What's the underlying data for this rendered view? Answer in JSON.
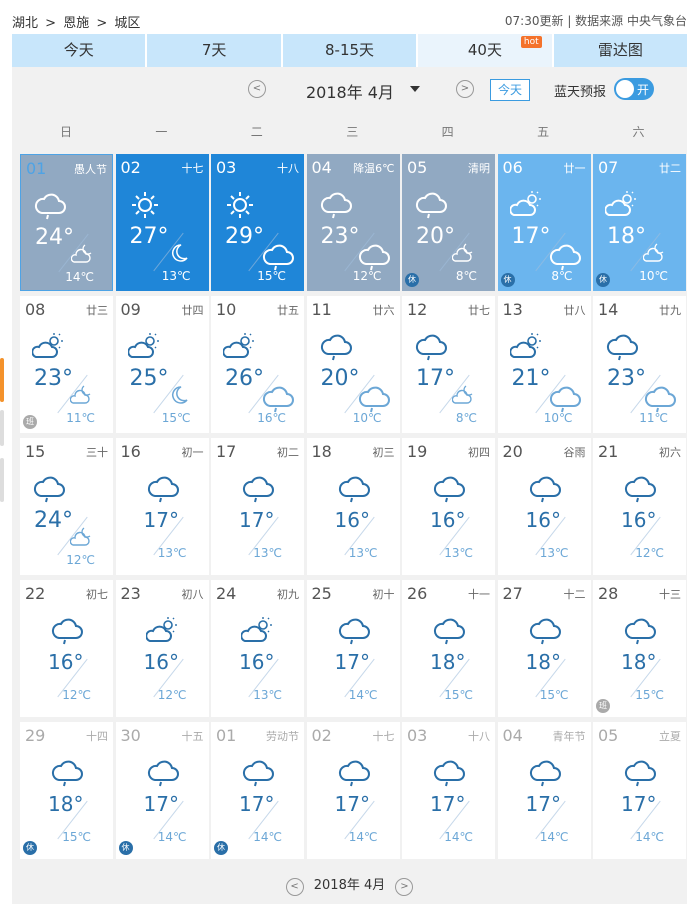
{
  "breadcrumb": [
    "湖北",
    ">",
    "恩施",
    ">",
    "城区"
  ],
  "update": {
    "time": "07:30更新",
    "source": "| 数据来源 中央气象台"
  },
  "tabs": [
    {
      "label": "今天"
    },
    {
      "label": "7天"
    },
    {
      "label": "8-15天"
    },
    {
      "label": "40天",
      "badge": "hot",
      "active": true
    },
    {
      "label": "雷达图"
    }
  ],
  "bar": {
    "month": "2018年 4月",
    "today": "今天",
    "lantian": "蓝天预报",
    "toggle": "开"
  },
  "weekdays": [
    "日",
    "一",
    "二",
    "三",
    "四",
    "五",
    "六"
  ],
  "cells": [
    {
      "day": "01",
      "lunar": "愚人节",
      "high": "24°",
      "low": "14℃",
      "style": "first",
      "w": "rain",
      "n": "cloud-moon",
      "tag": ""
    },
    {
      "day": "02",
      "lunar": "十七",
      "high": "27°",
      "low": "13℃",
      "style": "blue",
      "w": "sun",
      "n": "moon",
      "tag": ""
    },
    {
      "day": "03",
      "lunar": "十八",
      "high": "29°",
      "low": "15℃",
      "style": "blue",
      "w": "sun",
      "n": "rain",
      "tag": ""
    },
    {
      "day": "04",
      "lunar": "降温6℃",
      "high": "23°",
      "low": "12℃",
      "style": "grey",
      "w": "rain",
      "n": "rain",
      "tag": ""
    },
    {
      "day": "05",
      "lunar": "清明",
      "high": "20°",
      "low": "8℃",
      "style": "grey",
      "w": "rain",
      "n": "cloud-moon",
      "tag": "休"
    },
    {
      "day": "06",
      "lunar": "廿一",
      "high": "17°",
      "low": "8℃",
      "style": "light",
      "w": "sun-cloud",
      "n": "rain",
      "tag": "休"
    },
    {
      "day": "07",
      "lunar": "廿二",
      "high": "18°",
      "low": "10℃",
      "style": "light",
      "w": "sun-cloud",
      "n": "cloud-moon",
      "tag": "休"
    },
    {
      "day": "08",
      "lunar": "廿三",
      "high": "23°",
      "low": "11℃",
      "style": "",
      "w": "sun-cloud",
      "n": "cloud-moon",
      "tag": "班"
    },
    {
      "day": "09",
      "lunar": "廿四",
      "high": "25°",
      "low": "15℃",
      "style": "",
      "w": "sun-cloud",
      "n": "moon",
      "tag": ""
    },
    {
      "day": "10",
      "lunar": "廿五",
      "high": "26°",
      "low": "16℃",
      "style": "",
      "w": "sun-cloud",
      "n": "rain",
      "tag": ""
    },
    {
      "day": "11",
      "lunar": "廿六",
      "high": "20°",
      "low": "10℃",
      "style": "",
      "w": "rain",
      "n": "rain",
      "tag": ""
    },
    {
      "day": "12",
      "lunar": "廿七",
      "high": "17°",
      "low": "8℃",
      "style": "",
      "w": "rain",
      "n": "cloud-moon",
      "tag": ""
    },
    {
      "day": "13",
      "lunar": "廿八",
      "high": "21°",
      "low": "10℃",
      "style": "",
      "w": "sun-cloud",
      "n": "rain",
      "tag": ""
    },
    {
      "day": "14",
      "lunar": "廿九",
      "high": "23°",
      "low": "11℃",
      "style": "",
      "w": "rain",
      "n": "rain",
      "tag": ""
    },
    {
      "day": "15",
      "lunar": "三十",
      "high": "24°",
      "low": "12℃",
      "style": "",
      "w": "rain",
      "n": "cloud-moon",
      "tag": ""
    },
    {
      "day": "16",
      "lunar": "初一",
      "high": "17°",
      "low": "13℃",
      "style": "",
      "w": "rain",
      "n": "",
      "tag": ""
    },
    {
      "day": "17",
      "lunar": "初二",
      "high": "17°",
      "low": "13℃",
      "style": "",
      "w": "rain",
      "n": "",
      "tag": ""
    },
    {
      "day": "18",
      "lunar": "初三",
      "high": "16°",
      "low": "13℃",
      "style": "",
      "w": "rain",
      "n": "",
      "tag": ""
    },
    {
      "day": "19",
      "lunar": "初四",
      "high": "16°",
      "low": "13℃",
      "style": "",
      "w": "rain",
      "n": "",
      "tag": ""
    },
    {
      "day": "20",
      "lunar": "谷雨",
      "high": "16°",
      "low": "13℃",
      "style": "",
      "w": "rain",
      "n": "",
      "tag": ""
    },
    {
      "day": "21",
      "lunar": "初六",
      "high": "16°",
      "low": "12℃",
      "style": "",
      "w": "rain",
      "n": "",
      "tag": ""
    },
    {
      "day": "22",
      "lunar": "初七",
      "high": "16°",
      "low": "12℃",
      "style": "",
      "w": "rain",
      "n": "",
      "tag": ""
    },
    {
      "day": "23",
      "lunar": "初八",
      "high": "16°",
      "low": "12℃",
      "style": "",
      "w": "sun-cloud",
      "n": "",
      "tag": ""
    },
    {
      "day": "24",
      "lunar": "初九",
      "high": "16°",
      "low": "13℃",
      "style": "",
      "w": "sun-cloud",
      "n": "",
      "tag": ""
    },
    {
      "day": "25",
      "lunar": "初十",
      "high": "17°",
      "low": "14℃",
      "style": "",
      "w": "rain",
      "n": "",
      "tag": ""
    },
    {
      "day": "26",
      "lunar": "十一",
      "high": "18°",
      "low": "15℃",
      "style": "",
      "w": "rain",
      "n": "",
      "tag": ""
    },
    {
      "day": "27",
      "lunar": "十二",
      "high": "18°",
      "low": "15℃",
      "style": "",
      "w": "rain",
      "n": "",
      "tag": ""
    },
    {
      "day": "28",
      "lunar": "十三",
      "high": "18°",
      "low": "15℃",
      "style": "",
      "w": "rain",
      "n": "",
      "tag": "班"
    },
    {
      "day": "29",
      "lunar": "十四",
      "high": "18°",
      "low": "15℃",
      "style": "faded",
      "w": "rain",
      "n": "",
      "tag": "休"
    },
    {
      "day": "30",
      "lunar": "十五",
      "high": "17°",
      "low": "14℃",
      "style": "faded",
      "w": "rain",
      "n": "",
      "tag": "休"
    },
    {
      "day": "01",
      "lunar": "劳动节",
      "high": "17°",
      "low": "14℃",
      "style": "faded",
      "w": "rain",
      "n": "",
      "tag": "休"
    },
    {
      "day": "02",
      "lunar": "十七",
      "high": "17°",
      "low": "14℃",
      "style": "faded",
      "w": "rain",
      "n": "",
      "tag": ""
    },
    {
      "day": "03",
      "lunar": "十八",
      "high": "17°",
      "low": "14℃",
      "style": "faded",
      "w": "rain",
      "n": "",
      "tag": ""
    },
    {
      "day": "04",
      "lunar": "青年节",
      "high": "17°",
      "low": "14℃",
      "style": "faded",
      "w": "rain",
      "n": "",
      "tag": ""
    },
    {
      "day": "05",
      "lunar": "立夏",
      "high": "17°",
      "low": "14℃",
      "style": "faded",
      "w": "rain",
      "n": "",
      "tag": ""
    }
  ],
  "footer": {
    "month": "2018年 4月"
  },
  "colors": {
    "accent": "#3b9be0",
    "tab": "#c8e6fb",
    "blue": "#1f86d8",
    "grey": "#91a9c2",
    "light": "#6bb5ee"
  }
}
